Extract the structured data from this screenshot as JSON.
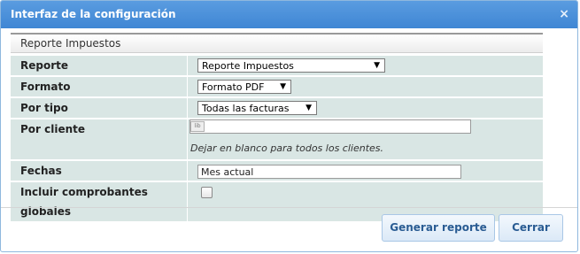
{
  "dialog": {
    "title": "Interfaz de la configuración",
    "close_glyph": "×"
  },
  "panel": {
    "header": "Reporte Impuestos"
  },
  "rows": {
    "reporte": {
      "label": "Reporte",
      "value": "Reporte Impuestos"
    },
    "formato": {
      "label": "Formato",
      "value": "Formato PDF"
    },
    "tipo": {
      "label": "Por tipo",
      "value": "Todas las facturas"
    },
    "cliente": {
      "label": "Por cliente",
      "value": "",
      "hint": "Dejar en blanco para todos los clientes."
    },
    "fechas": {
      "label": "Fechas",
      "value": "Mes actual"
    },
    "globales": {
      "label": "Incluir comprobantes globales",
      "checked": false
    }
  },
  "buttons": {
    "generate": "Generar reporte",
    "close": "Cerrar"
  },
  "icons": {
    "dropdown_arrow": "▼",
    "broken_image_icon": "lib"
  },
  "colors": {
    "titlebar": "#3f86d4",
    "row_bg": "#d9e6e4",
    "button_text": "#2a5c93"
  }
}
